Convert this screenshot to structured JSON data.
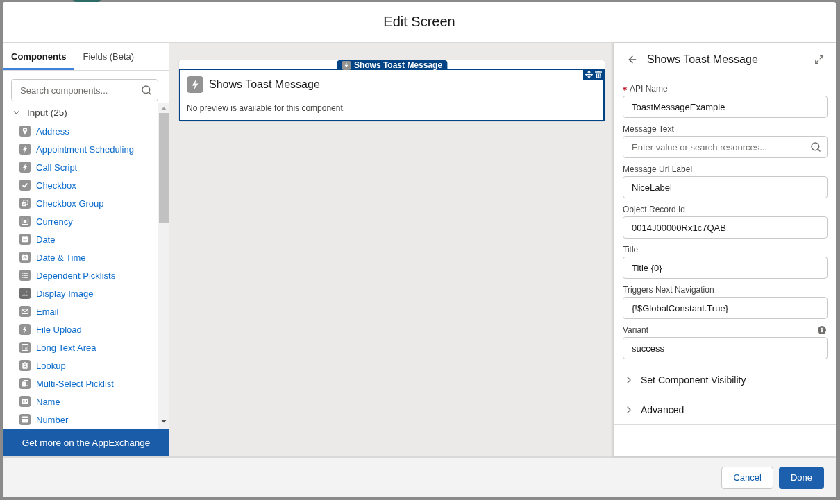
{
  "modal": {
    "title": "Edit Screen"
  },
  "sidebar": {
    "tabs": [
      {
        "label": "Components",
        "selected": true
      },
      {
        "label": "Fields (Beta)",
        "selected": false
      }
    ],
    "search": {
      "placeholder": "Search components..."
    },
    "group": {
      "label": "Input (25)",
      "expanded": true,
      "items": [
        "Address",
        "Appointment Scheduling",
        "Call Script",
        "Checkbox",
        "Checkbox Group",
        "Currency",
        "Date",
        "Date & Time",
        "Dependent Picklists",
        "Display Image",
        "Email",
        "File Upload",
        "Long Text Area",
        "Lookup",
        "Multi-Select Picklist",
        "Name",
        "Number"
      ]
    },
    "link": "Get more on the AppExchange"
  },
  "canvas": {
    "component": {
      "tag": "Shows Toast Message",
      "title": "Shows Toast Message",
      "note": "No preview is available for this component.",
      "selected": true
    }
  },
  "properties": {
    "title": "Shows Toast Message",
    "fields": [
      {
        "label": "API Name",
        "required": true,
        "help": false,
        "kind": "text",
        "value": "ToastMessageExample"
      },
      {
        "label": "Message Text",
        "required": false,
        "help": false,
        "kind": "search",
        "placeholder": "Enter value or search resources..."
      },
      {
        "label": "Message Url Label",
        "required": false,
        "help": false,
        "kind": "text",
        "value": "NiceLabel"
      },
      {
        "label": "Object Record Id",
        "required": false,
        "help": false,
        "kind": "text",
        "value": "0014J00000Rx1c7QAB"
      },
      {
        "label": "Title",
        "required": false,
        "help": false,
        "kind": "text",
        "value": "Title {0}"
      },
      {
        "label": "Triggers Next Navigation",
        "required": false,
        "help": false,
        "kind": "text",
        "value": "{!$GlobalConstant.True}"
      },
      {
        "label": "Variant",
        "required": false,
        "help": true,
        "kind": "text",
        "value": "success"
      }
    ],
    "sections": [
      {
        "label": "Set Component Visibility",
        "expanded": false
      },
      {
        "label": "Advanced",
        "expanded": false
      }
    ]
  },
  "footer": {
    "buttons": [
      {
        "label": "Cancel",
        "kind": "neutral"
      },
      {
        "label": "Done",
        "kind": "brand"
      }
    ]
  }
}
